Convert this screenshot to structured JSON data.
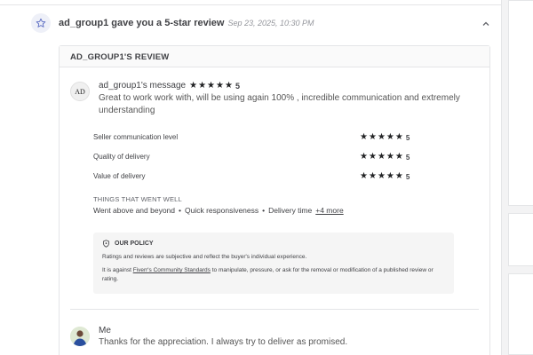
{
  "notification": {
    "title": "ad_group1 gave you a 5-star review",
    "date": "Sep 23, 2025, 10:30 PM"
  },
  "review": {
    "header": "AD_GROUP1'S REVIEW",
    "avatar_text": "AD",
    "message_label": "ad_group1's message",
    "overall_rating": "5",
    "message_text": "Great to work work with, will be using again 100% , incredible communication and extremely understanding",
    "ratings": [
      {
        "label": "Seller communication level",
        "value": "5"
      },
      {
        "label": "Quality of delivery",
        "value": "5"
      },
      {
        "label": "Value of delivery",
        "value": "5"
      }
    ],
    "went_well_title": "THINGS THAT WENT WELL",
    "went_well": [
      "Went above and beyond",
      "Quick responsiveness",
      "Delivery time"
    ],
    "more_link": "+4 more"
  },
  "policy": {
    "title": "OUR POLICY",
    "p1": "Ratings and reviews are subjective and reflect the buyer's individual experience.",
    "p2_before": "It is against ",
    "p2_link": "Fiverr's Community Standards",
    "p2_after": " to manipulate, pressure, or ask for the removal or modification of a published review or rating."
  },
  "reply": {
    "name": "Me",
    "text": "Thanks for the appreciation. I always try to deliver as promised."
  },
  "colors": {
    "star": "#222325",
    "text": "#404145",
    "muted": "#95979d"
  }
}
